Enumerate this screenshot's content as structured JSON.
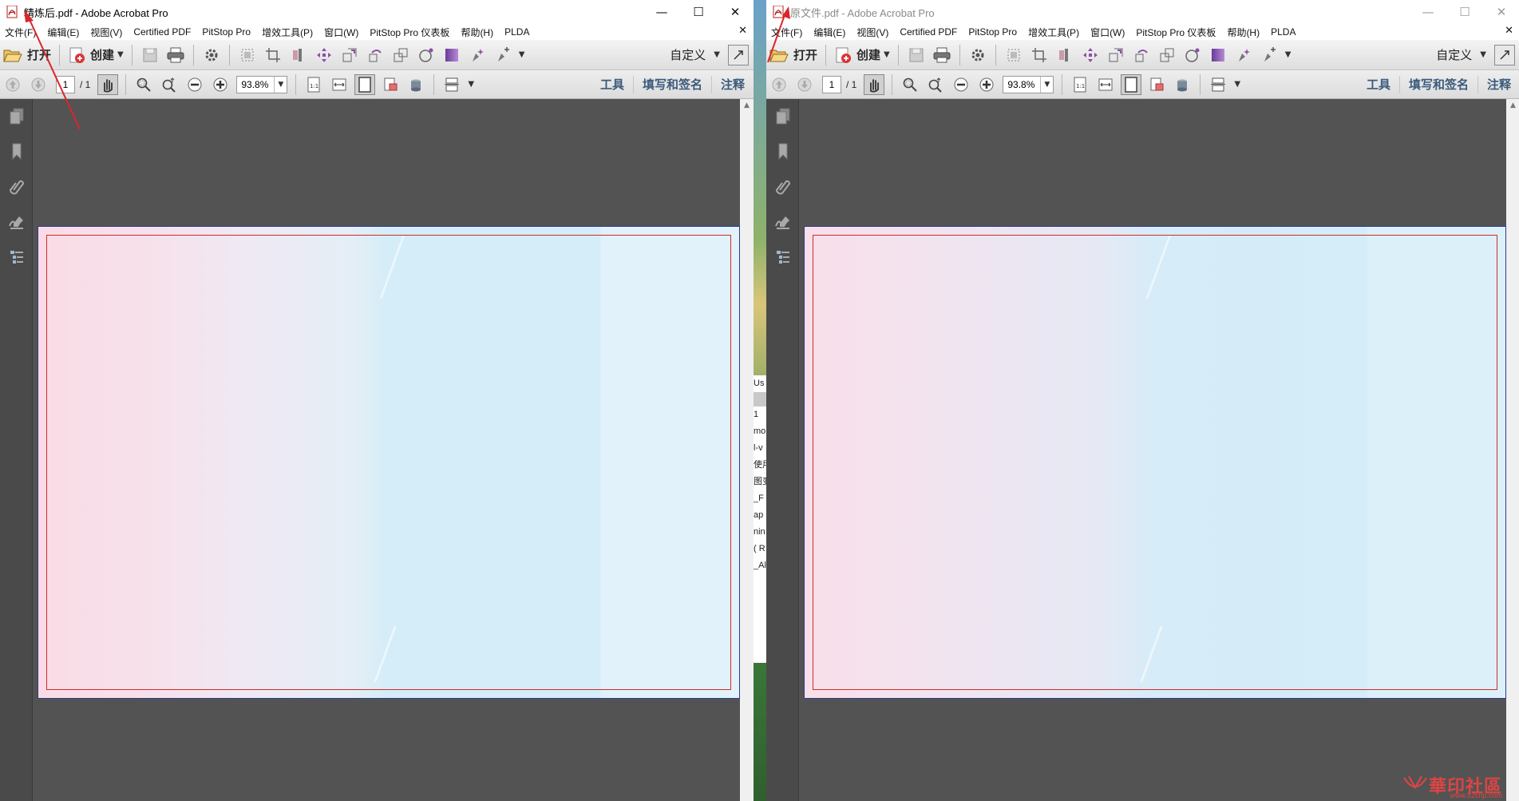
{
  "left_window": {
    "title": "精炼后.pdf - Adobe Acrobat Pro",
    "menu": [
      "文件(F)",
      "编辑(E)",
      "视图(V)",
      "Certified PDF",
      "PitStop Pro",
      "增效工具(P)",
      "窗口(W)",
      "PitStop Pro 仪表板",
      "帮助(H)",
      "PLDA"
    ],
    "open_label": "打开",
    "create_label": "创建",
    "customize_label": "自定义",
    "page_current": "1",
    "page_total": "/ 1",
    "zoom": "93.8%",
    "tabs": [
      "工具",
      "填写和签名",
      "注释"
    ]
  },
  "right_window": {
    "title": "原文件.pdf - Adobe Acrobat Pro",
    "menu": [
      "文件(F)",
      "编辑(E)",
      "视图(V)",
      "Certified PDF",
      "PitStop Pro",
      "增效工具(P)",
      "窗口(W)",
      "PitStop Pro 仪表板",
      "帮助(H)",
      "PLDA"
    ],
    "open_label": "打开",
    "create_label": "创建",
    "customize_label": "自定义",
    "page_current": "1",
    "page_total": "/ 1",
    "zoom": "93.8%",
    "tabs": [
      "工具",
      "填写和签名",
      "注释"
    ]
  },
  "desktop_peek": [
    "Us",
    "1",
    "mo",
    "l-v",
    "使用",
    "图变",
    "_F",
    "ap",
    "nin",
    "( R",
    "_All"
  ],
  "watermark": {
    "text": "華印社區",
    "url": "www.52cnp.com"
  },
  "colors": {
    "arrow": "#d9262a",
    "page_border": "#2d3a8a",
    "trim": "#d02a2a",
    "page_pink": "#f8dde6",
    "page_blue": "#d4edf8"
  }
}
